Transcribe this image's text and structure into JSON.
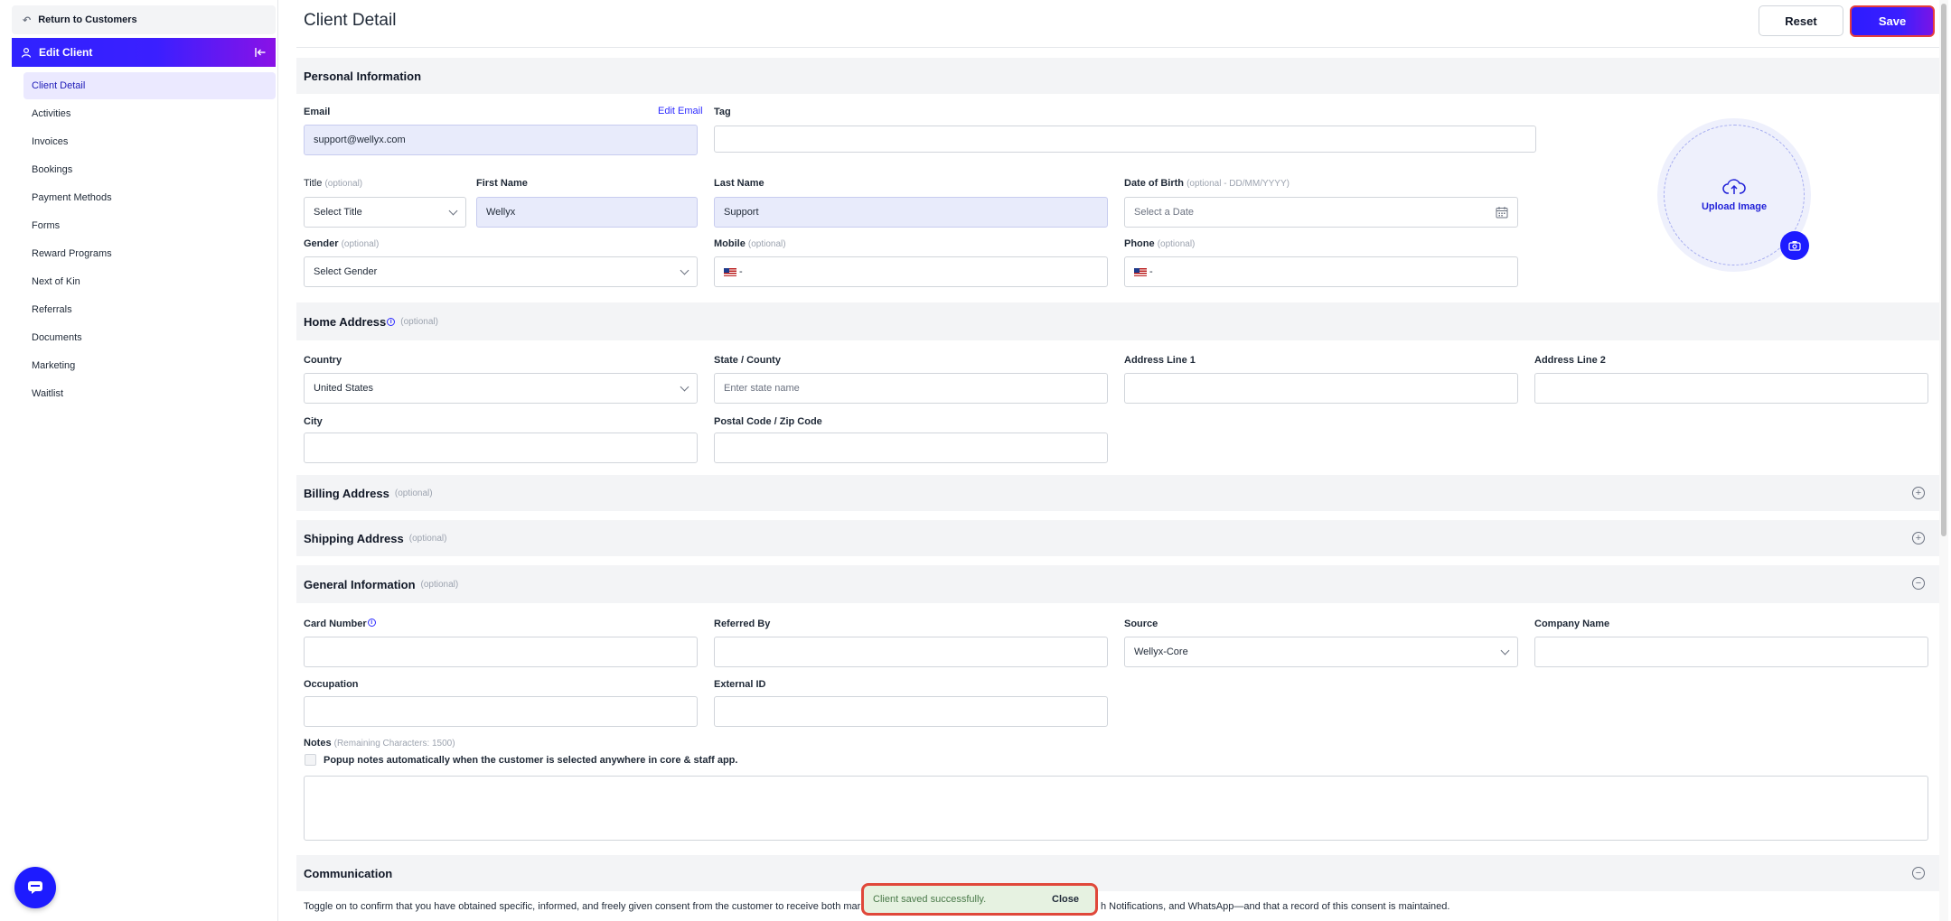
{
  "sidebar": {
    "return_label": "Return to Customers",
    "edit_header": "Edit Client",
    "items": [
      {
        "label": "Client Detail"
      },
      {
        "label": "Activities"
      },
      {
        "label": "Invoices"
      },
      {
        "label": "Bookings"
      },
      {
        "label": "Payment Methods"
      },
      {
        "label": "Forms"
      },
      {
        "label": "Reward Programs"
      },
      {
        "label": "Next of Kin"
      },
      {
        "label": "Referrals"
      },
      {
        "label": "Documents"
      },
      {
        "label": "Marketing"
      },
      {
        "label": "Waitlist"
      }
    ]
  },
  "header": {
    "title": "Client Detail",
    "reset_label": "Reset",
    "save_label": "Save"
  },
  "personal": {
    "title": "Personal Information",
    "email_label": "Email",
    "edit_email": "Edit Email",
    "email_value": "support@wellyx.com",
    "tag_label": "Tag",
    "title_label": "Title",
    "title_opt": "(optional)",
    "title_value": "Select Title",
    "first_name_label": "First Name",
    "first_name_value": "Wellyx",
    "last_name_label": "Last Name",
    "last_name_value": "Support",
    "dob_label": "Date of Birth",
    "dob_opt": "(optional - DD/MM/YYYY)",
    "dob_placeholder": "Select a Date",
    "gender_label": "Gender",
    "gender_opt": "(optional)",
    "gender_value": "Select Gender",
    "mobile_label": "Mobile",
    "mobile_opt": "(optional)",
    "mobile_prefix": "-",
    "phone_label": "Phone",
    "phone_opt": "(optional)",
    "phone_prefix": "-",
    "upload_label": "Upload Image"
  },
  "home": {
    "title": "Home Address",
    "opt": "(optional)",
    "country_label": "Country",
    "country_value": "United States",
    "state_label": "State / County",
    "state_placeholder": "Enter state name",
    "addr1_label": "Address Line 1",
    "addr2_label": "Address Line 2",
    "city_label": "City",
    "postal_label": "Postal Code / Zip Code"
  },
  "billing": {
    "title": "Billing Address",
    "opt": "(optional)"
  },
  "shipping": {
    "title": "Shipping Address",
    "opt": "(optional)"
  },
  "general": {
    "title": "General Information",
    "opt": "(optional)",
    "card_label": "Card Number",
    "referred_label": "Referred By",
    "source_label": "Source",
    "source_value": "Wellyx-Core",
    "company_label": "Company Name",
    "occupation_label": "Occupation",
    "external_label": "External ID",
    "notes_label": "Notes",
    "notes_remaining": "(Remaining Characters: 1500)",
    "popup_label": "Popup notes automatically when the customer is selected anywhere in core & staff app."
  },
  "communication": {
    "title": "Communication",
    "consent_start": "Toggle on to confirm that you have obtained specific, informed, and freely given consent from the customer to receive both marketi",
    "consent_end": "h Notifications, and WhatsApp—and that a record of this consent is maintained."
  },
  "toast": {
    "message": "Client saved successfully.",
    "close": "Close"
  },
  "colors": {
    "accent": "#1d1bff",
    "highlight_border": "#e53e3e",
    "toast_bg": "#e6f2e1"
  }
}
